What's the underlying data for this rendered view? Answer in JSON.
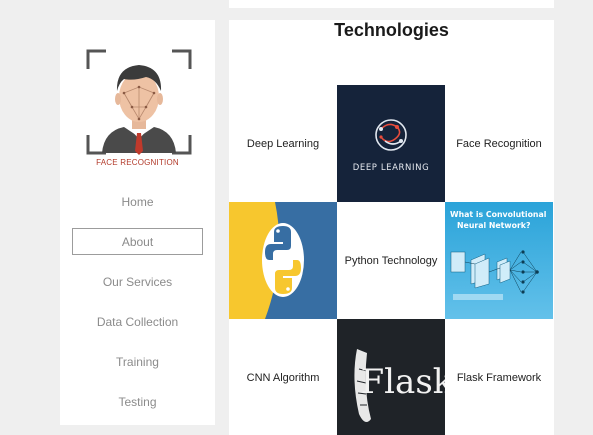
{
  "brand": {
    "caption": "FACE RECOGNITION"
  },
  "nav": {
    "items": [
      {
        "label": "Home"
      },
      {
        "label": "About",
        "active": true
      },
      {
        "label": "Our Services"
      },
      {
        "label": "Data Collection"
      },
      {
        "label": "Training"
      },
      {
        "label": "Testing"
      }
    ]
  },
  "content": {
    "title": "Technologies",
    "cells": [
      {
        "type": "label",
        "text": "Deep Learning"
      },
      {
        "type": "image",
        "icon": "deep-learning-image",
        "caption": "DEEP LEARNING"
      },
      {
        "type": "label",
        "text": "Face Recognition"
      },
      {
        "type": "image",
        "icon": "python-logo-image"
      },
      {
        "type": "label",
        "text": "Python Technology"
      },
      {
        "type": "image",
        "icon": "cnn-diagram-image",
        "caption_line1": "What is Convolutional",
        "caption_line2": "Neural Network?"
      },
      {
        "type": "label",
        "text": "CNN Algorithm"
      },
      {
        "type": "image",
        "icon": "flask-logo-image",
        "caption": "Flask"
      },
      {
        "type": "label",
        "text": "Flask Framework"
      }
    ]
  },
  "colors": {
    "page_bg": "#efefef",
    "accent_red": "#b23a2a",
    "deep_learning_bg": "#15233a",
    "python_yellow": "#f7c72e",
    "python_blue": "#376ea3",
    "cnn_blue": "#2aa3d9",
    "flask_bg": "#1f2328"
  }
}
